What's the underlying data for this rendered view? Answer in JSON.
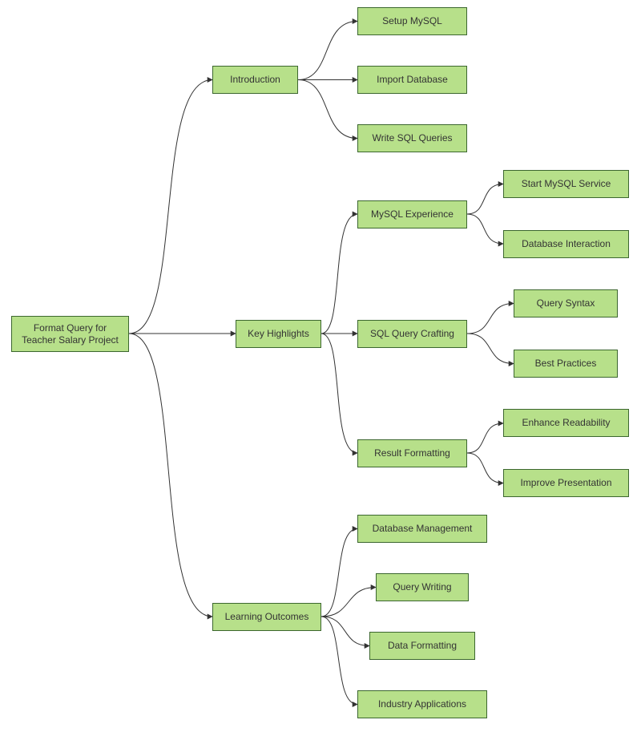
{
  "root": {
    "label": "Format Query for Teacher Salary Project"
  },
  "introduction": {
    "label": "Introduction",
    "children": {
      "setup": "Setup MySQL",
      "import": "Import Database",
      "write": "Write SQL Queries"
    }
  },
  "keyHighlights": {
    "label": "Key Highlights",
    "children": {
      "mysqlExp": {
        "label": "MySQL Experience",
        "children": {
          "start": "Start MySQL Service",
          "interact": "Database Interaction"
        }
      },
      "sqlCraft": {
        "label": "SQL Query Crafting",
        "children": {
          "syntax": "Query Syntax",
          "best": "Best Practices"
        }
      },
      "resultFmt": {
        "label": "Result Formatting",
        "children": {
          "read": "Enhance Readability",
          "pres": "Improve Presentation"
        }
      }
    }
  },
  "learningOutcomes": {
    "label": "Learning Outcomes",
    "children": {
      "dbmgmt": "Database Management",
      "qwriting": "Query Writing",
      "dformat": "Data Formatting",
      "industry": "Industry Applications"
    }
  }
}
